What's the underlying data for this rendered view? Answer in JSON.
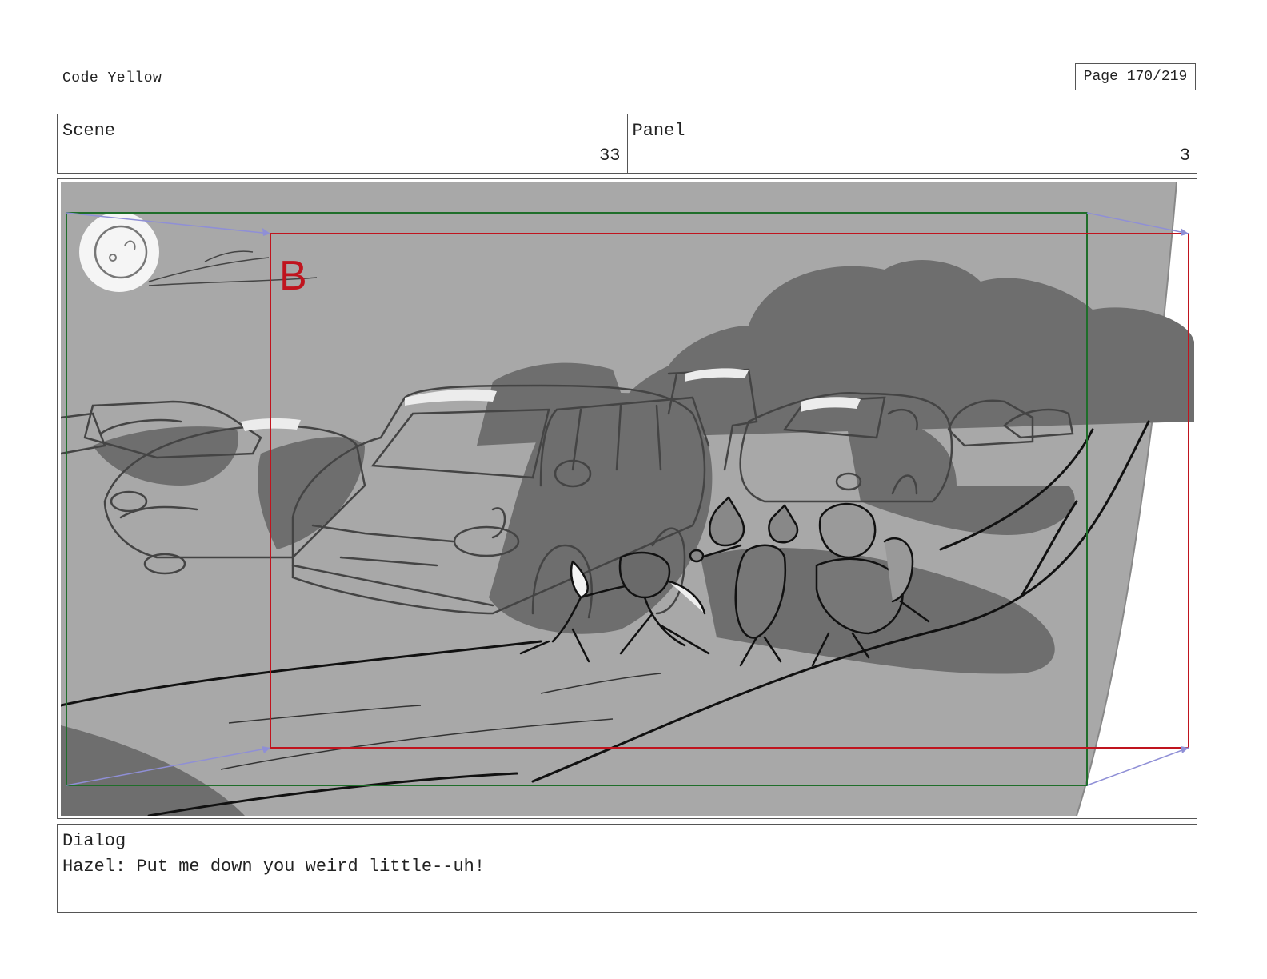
{
  "header": {
    "title": "Code Yellow",
    "page_label": "Page 170/219"
  },
  "meta": {
    "scene_label": "Scene",
    "scene_value": "33",
    "panel_label": "Panel",
    "panel_value": "3"
  },
  "frame": {
    "marker_letter": "B",
    "colors": {
      "safe_frame": "#1f6e2a",
      "action_frame": "#c0141e",
      "move_arrow": "#8f8fd6",
      "background": "#a8a8a8",
      "smoke": "#6e6e6e"
    }
  },
  "dialog": {
    "label": "Dialog",
    "text": "Hazel: Put me down you weird little--uh!"
  }
}
